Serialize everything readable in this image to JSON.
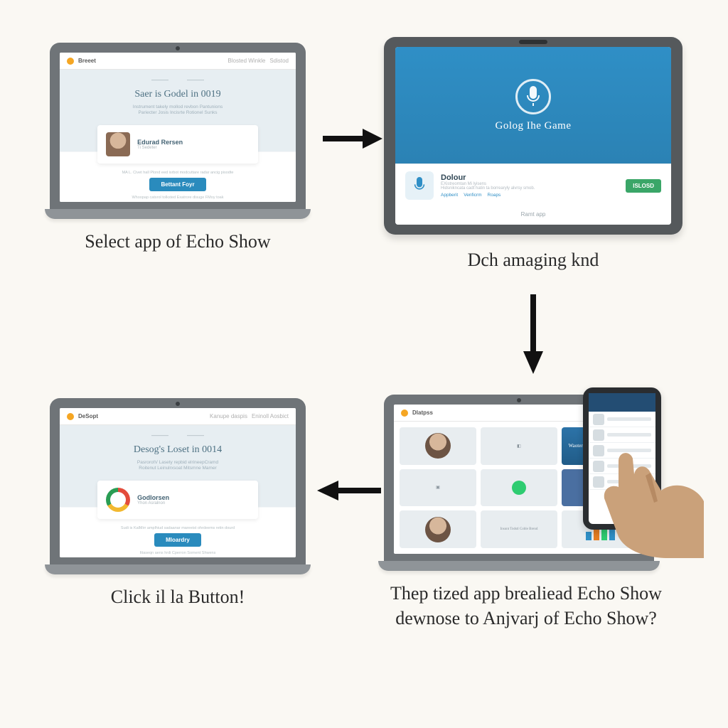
{
  "step1": {
    "brand": "Breeet",
    "navA": "Blosted Winkle",
    "navB": "Sdistod",
    "title": "Saer is Godel in 0019",
    "sub1": "Instrument takely mollod revbon Pantunions",
    "sub2": "Pariecter Josis Incisrte Rotionel Sunks",
    "card_name": "Edurad Rersen",
    "card_role": "Ti Sedeter",
    "cta_sub": "MA L. Civet hall Plond eed isrbot modcuttare radar ancig pisodte",
    "cta": "Bettant Foyr",
    "footer": "Whoopap catsrol tolksted Exatrore disuge FMoy toak",
    "caption": "Select app of Echo Show"
  },
  "step2": {
    "hero_title": "Golog Ihe Game",
    "app_name": "Dolour",
    "app_pub": "EXistreomtan Mi lyisens",
    "app_desc": "Hidsnikncata cadt hatin ta borrearyly alvrsy smob.",
    "linkA": "Appberit",
    "linkB": "Venficrm",
    "linkC": "Roaps",
    "install": "ISLOSD",
    "foot": "Ramt app",
    "caption": "Dch amaging knd"
  },
  "step3": {
    "brand": "DeSopt",
    "navA": "Kanupe daspis",
    "navB": "Eninoll Aosbict",
    "title": "Desog's Loset in 0014",
    "sub1": "PasrorotV  Lasety repbid elrineepCramd",
    "sub2": "Roitenut Leinulrxsoat Mitsmne Mamer",
    "card_name": "Godlorsen",
    "card_role": "Yhon Asralnon",
    "cta_sub": "Sudi is KalMirr amplhiud sadaanar mareeist ohrdeems retin dourd",
    "cta": "Mloardry",
    "footer": "Ittaseqn aens hrdi Cperron Soment Shwens",
    "caption": "Click il la Button!"
  },
  "step4": {
    "brand": "Dlatpss",
    "hero_title": "Waoter Paroloing watts a Vaues",
    "section_label": "Insunt Todstl Coble Brend",
    "caption": "Thep tized app brealiead Echo Show dewnose to Anjvarj of Echo Show?"
  }
}
